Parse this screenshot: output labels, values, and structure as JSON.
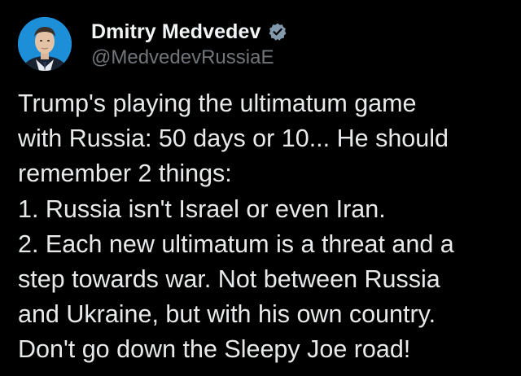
{
  "author": {
    "display_name": "Dmitry Medvedev",
    "handle": "@MedvedevRussiaE",
    "verified": true,
    "verified_badge_color": "#829aab",
    "avatar_background": "#1d9bf0"
  },
  "tweet": {
    "lines": [
      "Trump's playing the ultimatum game",
      "with Russia: 50 days or 10... He should",
      "remember 2 things:",
      "1. Russia isn't Israel or even Iran.",
      "2. Each new ultimatum is a threat and a",
      "step towards war. Not between Russia",
      "and Ukraine, but with his own country.",
      "Don't go down the Sleepy Joe road!"
    ]
  },
  "colors": {
    "background": "#000000",
    "text_primary": "#e7e9ea",
    "text_secondary": "#71767b"
  }
}
